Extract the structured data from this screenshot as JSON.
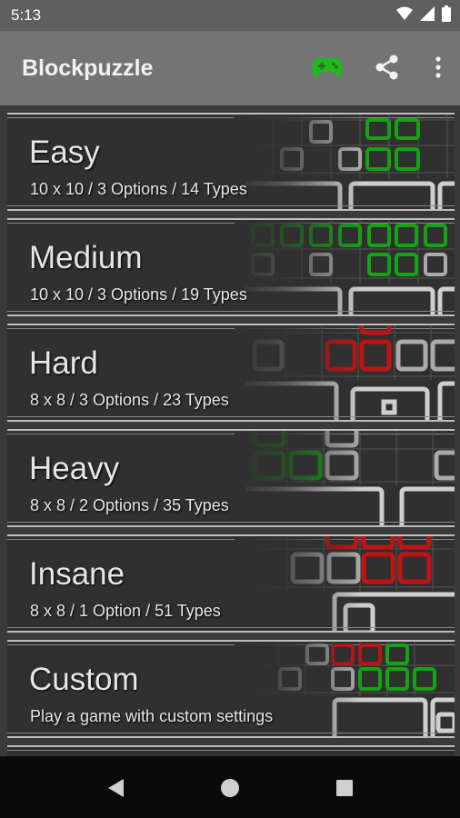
{
  "status_bar": {
    "time": "5:13",
    "icons": [
      "wifi-icon",
      "signal-icon",
      "battery-icon"
    ]
  },
  "app_bar": {
    "title": "Blockpuzzle",
    "actions": [
      "gamepad-icon",
      "share-icon",
      "overflow-menu-icon"
    ],
    "accent_color": "#1fb81f"
  },
  "modes": [
    {
      "title": "Easy",
      "subtitle": "10 x 10 / 3 Options / 14 Types",
      "accent": "green"
    },
    {
      "title": "Medium",
      "subtitle": "10 x 10 / 3 Options / 19 Types",
      "accent": "green"
    },
    {
      "title": "Hard",
      "subtitle": "8 x 8 / 3 Options / 23 Types",
      "accent": "red"
    },
    {
      "title": "Heavy",
      "subtitle": "8 x 8 / 2 Options / 35 Types",
      "accent": "green"
    },
    {
      "title": "Insane",
      "subtitle": "8 x 8 / 1 Option / 51 Types",
      "accent": "red"
    },
    {
      "title": "Custom",
      "subtitle": "Play a game with custom settings",
      "accent": "mixed"
    }
  ],
  "colors": {
    "green": "#13a313",
    "red": "#c01414",
    "block_outline": "#bdbdbd"
  },
  "nav_bar": {
    "buttons": [
      "back-icon",
      "home-icon",
      "recents-icon"
    ]
  }
}
